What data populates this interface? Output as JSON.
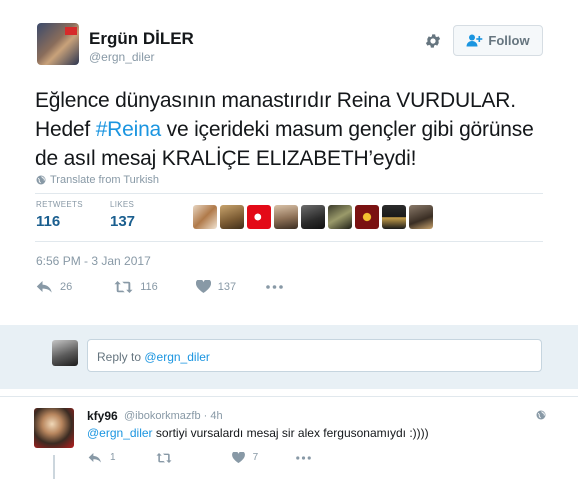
{
  "tweet": {
    "author_name": "Ergün DİLER",
    "author_handle": "@ergn_diler",
    "follow_label": "Follow",
    "text_part1": "Eğlence dünyasının manastırıdır Reina VURDULAR. Hedef ",
    "hashtag": "#Reina",
    "text_part2": " ve içerideki masum gençler gibi görünse de asıl mesaj KRALİÇE ELIZABETH’eydi!",
    "translate_label": "Translate from Turkish",
    "retweets_label": "RETWEETS",
    "retweets_count": "116",
    "likes_label": "LIKES",
    "likes_count": "137",
    "timestamp": "6:56 PM - 3 Jan 2017",
    "actions": {
      "replies": "26",
      "retweets": "116",
      "likes": "137"
    }
  },
  "reply_box": {
    "placeholder_prefix": "Reply to ",
    "placeholder_mention": "@ergn_diler"
  },
  "reply": {
    "author_name": "kfy96",
    "author_handle": "@ibokorkmazfb · 4h",
    "mention": "@ergn_diler",
    "text": " sortiyi vursalardı mesaj sir alex fergusonamıydı :))))",
    "actions": {
      "replies": "1",
      "retweets": "",
      "likes": "7"
    }
  },
  "colors": {
    "link": "#1b95e0",
    "muted": "#8899a6",
    "reply_bg": "#e8f0f5"
  },
  "icons": [
    "gear-icon",
    "follow-user-icon",
    "globe-icon",
    "reply-icon",
    "retweet-icon",
    "like-icon",
    "more-icon"
  ]
}
